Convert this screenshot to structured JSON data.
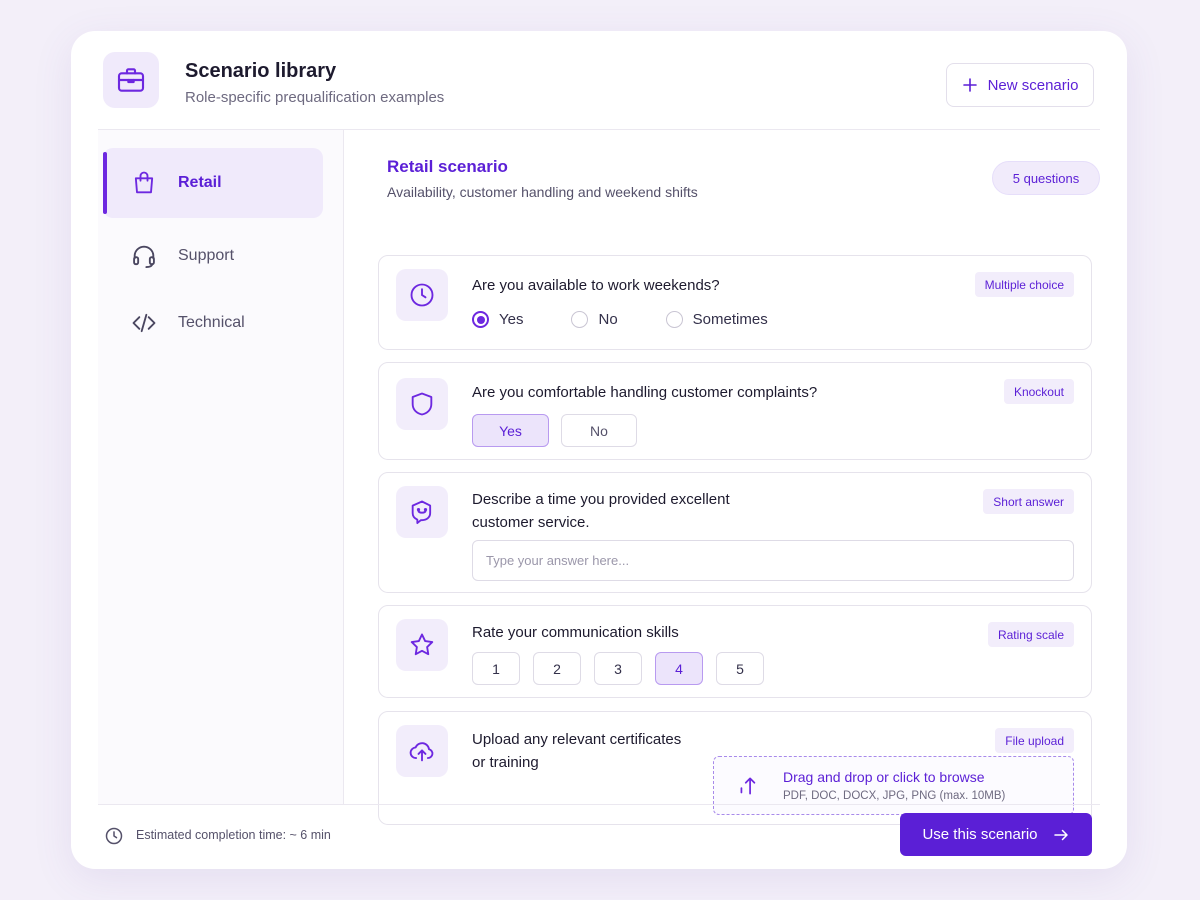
{
  "header": {
    "title": "Scenario library",
    "subtitle": "Role-specific prequalification examples",
    "new_button_label": "New scenario"
  },
  "sidebar": {
    "items": [
      {
        "label": "Retail",
        "icon": "shopping-bag-icon",
        "active": true
      },
      {
        "label": "Support",
        "icon": "headset-icon",
        "active": false
      },
      {
        "label": "Technical",
        "icon": "code-icon",
        "active": false
      }
    ]
  },
  "scenario": {
    "title": "Retail scenario",
    "subtitle": "Availability, customer handling and weekend shifts",
    "question_count": "5 questions"
  },
  "questions": [
    {
      "text": "Are you available to work weekends?",
      "tag": "Multiple choice",
      "icon": "clock-icon",
      "options": [
        "Yes",
        "No",
        "Sometimes"
      ],
      "selected": "Yes"
    },
    {
      "text": "Are you comfortable handling customer complaints?",
      "tag": "Knockout",
      "icon": "shield-icon",
      "options": [
        "Yes",
        "No"
      ],
      "selected": "Yes"
    },
    {
      "text_line1": "Describe a time you provided excellent",
      "text_line2": "customer service.",
      "tag": "Short answer",
      "icon": "chat-icon",
      "placeholder": "Type your answer here...",
      "value": ""
    },
    {
      "text": "Rate your communication skills",
      "tag": "Rating scale",
      "icon": "star-icon",
      "options": [
        "1",
        "2",
        "3",
        "4",
        "5"
      ],
      "selected": "4"
    },
    {
      "text_line1": "Upload any relevant certificates",
      "text_line2": "or training",
      "tag": "File upload",
      "icon": "cloud-upload-icon",
      "drop_title": "Drag and drop or click to browse",
      "drop_hint": "PDF, DOC, DOCX, JPG, PNG (max. 10MB)"
    }
  ],
  "footer": {
    "estimate": "Estimated completion time: ~ 6 min",
    "use_button_label": "Use this scenario"
  },
  "colors": {
    "accent": "#5b1fd6",
    "accent_light": "#f0eafb",
    "background": "#f3eff9"
  }
}
